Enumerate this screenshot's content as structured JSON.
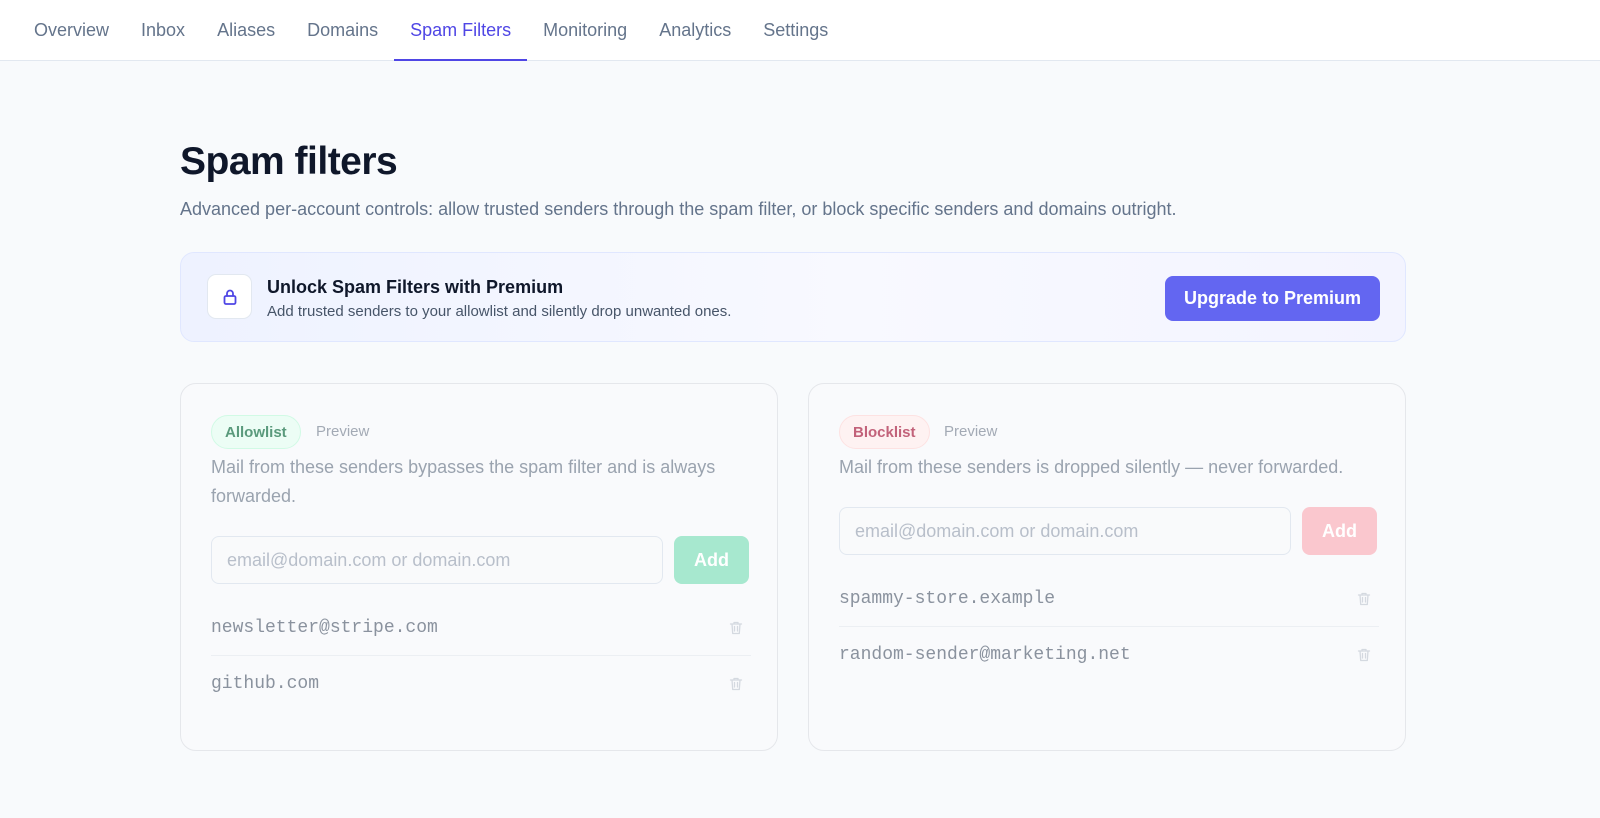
{
  "nav": {
    "tabs": [
      {
        "label": "Overview"
      },
      {
        "label": "Inbox"
      },
      {
        "label": "Aliases"
      },
      {
        "label": "Domains"
      },
      {
        "label": "Spam Filters",
        "active": true
      },
      {
        "label": "Monitoring"
      },
      {
        "label": "Analytics"
      },
      {
        "label": "Settings"
      }
    ]
  },
  "page": {
    "title": "Spam filters",
    "subtitle": "Advanced per-account controls: allow trusted senders through the spam filter, or block specific senders and domains outright."
  },
  "banner": {
    "icon": "lock-icon",
    "title": "Unlock Spam Filters with Premium",
    "description": "Add trusted senders to your allowlist and silently drop unwanted ones.",
    "button_label": "Upgrade to Premium"
  },
  "allowlist": {
    "badge": "Allowlist",
    "preview_label": "Preview",
    "description": "Mail from these senders bypasses the spam filter and is always forwarded.",
    "input_placeholder": "email@domain.com or domain.com",
    "add_label": "Add",
    "entries": [
      "newsletter@stripe.com",
      "github.com"
    ]
  },
  "blocklist": {
    "badge": "Blocklist",
    "preview_label": "Preview",
    "description": "Mail from these senders is dropped silently — never forwarded.",
    "input_placeholder": "email@domain.com or domain.com",
    "add_label": "Add",
    "entries": [
      "spammy-store.example",
      "random-sender@marketing.net"
    ]
  },
  "colors": {
    "accent": "#6366f1",
    "active_tab": "#4f46e5",
    "allow_green": "#a7e8cf",
    "block_red": "#fac7ce"
  }
}
